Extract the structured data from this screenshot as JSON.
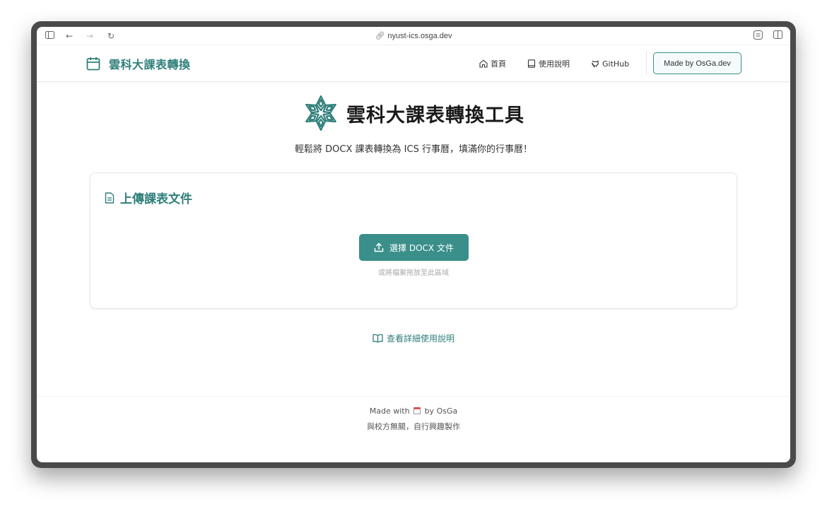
{
  "browser": {
    "url": "nyust-ics.osga.dev"
  },
  "header": {
    "brand": "雲科大課表轉換",
    "nav": [
      {
        "label": "首頁",
        "icon": "home-icon"
      },
      {
        "label": "使用說明",
        "icon": "book-icon"
      },
      {
        "label": "GitHub",
        "icon": "github-icon"
      }
    ],
    "made_by_label": "Made by OsGa.dev"
  },
  "hero": {
    "title": "雲科大課表轉換工具",
    "subtitle": "輕鬆將 DOCX 課表轉換為 ICS 行事曆，填滿你的行事曆！"
  },
  "upload_card": {
    "title": "上傳課表文件",
    "button_label": "選擇 DOCX 文件",
    "drop_hint": "或將檔案拖放至此區域"
  },
  "guide_link": "查看詳細使用說明",
  "footer": {
    "made_with_prefix": "Made with",
    "made_with_suffix": "by OsGa",
    "disclaimer": "與校方無關，自行興趣製作"
  },
  "colors": {
    "accent": "#3a8f8a",
    "accent_text": "#2f7f7b"
  }
}
